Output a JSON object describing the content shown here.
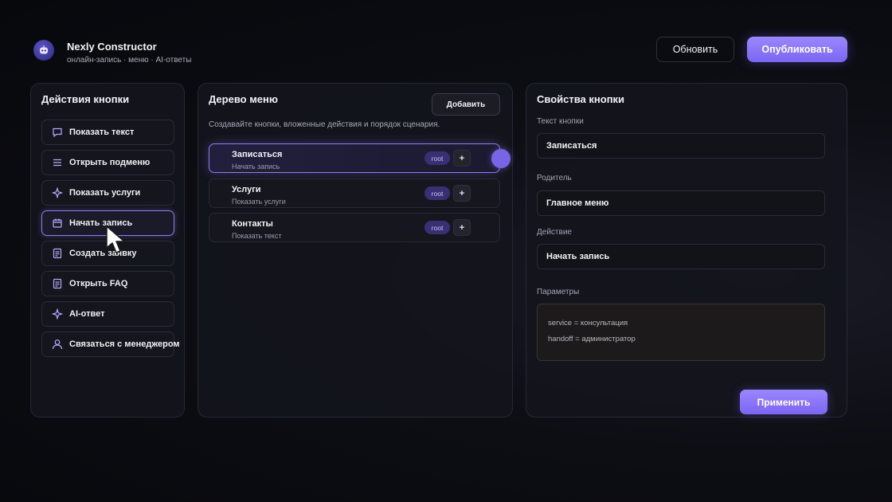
{
  "header": {
    "title": "Nexly Constructor",
    "subtitle": "онлайн-запись · меню · AI-ответы",
    "refresh_label": "Обновить",
    "publish_label": "Опубликовать",
    "logo_icon": "bot-icon"
  },
  "actions_panel": {
    "title": "Действия кнопки",
    "items": [
      {
        "label": "Показать текст",
        "icon": "chat-bubble-icon"
      },
      {
        "label": "Открыть подменю",
        "icon": "menu-lines-icon"
      },
      {
        "label": "Показать услуги",
        "icon": "sparkle-icon"
      },
      {
        "label": "Начать запись",
        "icon": "calendar-icon",
        "active": true
      },
      {
        "label": "Создать заявку",
        "icon": "document-icon"
      },
      {
        "label": "Открыть FAQ",
        "icon": "document-icon"
      },
      {
        "label": "AI-ответ",
        "icon": "sparkle-icon"
      },
      {
        "label": "Связаться с менеджером",
        "icon": "user-icon"
      }
    ]
  },
  "tree_panel": {
    "title": "Дерево меню",
    "add_label": "Добавить",
    "description": "Создавайте кнопки, вложенные действия и порядок сценария.",
    "items": [
      {
        "name": "Записаться",
        "sub": "Начать запись",
        "tag": "root",
        "plus": "+",
        "selected": true
      },
      {
        "name": "Услуги",
        "sub": "Показать услуги",
        "tag": "root",
        "plus": "+"
      },
      {
        "name": "Контакты",
        "sub": "Показать текст",
        "tag": "root",
        "plus": "+"
      }
    ]
  },
  "props_panel": {
    "title": "Свойства кнопки",
    "text_label": "Текст кнопки",
    "text_value": "Записаться",
    "parent_label": "Родитель",
    "parent_value": "Главное меню",
    "action_label": "Действие",
    "action_value": "Начать запись",
    "params_label": "Параметры",
    "params": [
      "service = консультация",
      "handoff = администратор"
    ],
    "apply_label": "Применить"
  },
  "colors": {
    "accent": "#8f7cf6",
    "accent_button": "#7b65f2",
    "background": "#0d0e14",
    "panel": "#14151c"
  }
}
